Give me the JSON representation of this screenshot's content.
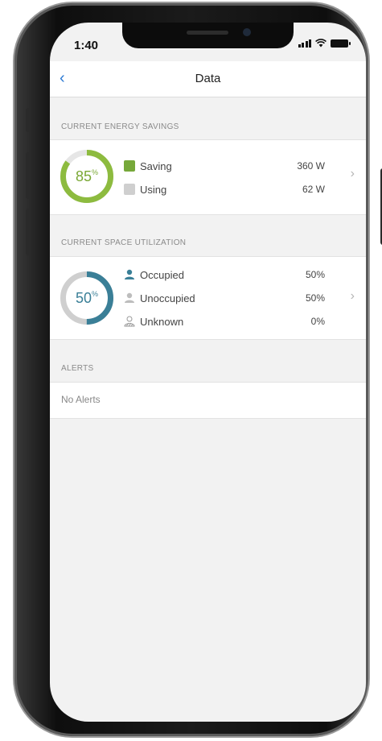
{
  "status_bar": {
    "time": "1:40"
  },
  "navbar": {
    "back_icon": "chevron-left-icon",
    "title": "Data"
  },
  "energy": {
    "header": "CURRENT ENERGY SAVINGS",
    "percent": "85",
    "percent_sign": "%",
    "saving_fraction": 0.85,
    "ring_color": "#8dbb3f",
    "rows": [
      {
        "label": "Saving",
        "value": "360 W",
        "color": "#76a83a"
      },
      {
        "label": "Using",
        "value": "62 W",
        "color": "#cfcfcf"
      }
    ]
  },
  "space": {
    "header": "CURRENT SPACE UTILIZATION",
    "percent": "50",
    "percent_sign": "%",
    "occupied_fraction": 0.5,
    "ring_color": "#3a7f97",
    "rows": [
      {
        "label": "Occupied",
        "value": "50%",
        "icon": "person-icon",
        "color": "#3a7f97"
      },
      {
        "label": "Unoccupied",
        "value": "50%",
        "icon": "person-icon",
        "color": "#bdbdbd"
      },
      {
        "label": "Unknown",
        "value": "0%",
        "icon": "person-hatched-icon",
        "color": "#9a9a9a"
      }
    ]
  },
  "alerts": {
    "header": "ALERTS",
    "empty_text": "No Alerts"
  }
}
